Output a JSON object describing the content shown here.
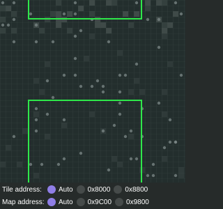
{
  "tile_address": {
    "label": "Tile address:",
    "options": [
      {
        "label": "Auto",
        "selected": true
      },
      {
        "label": "0x8000",
        "selected": false
      },
      {
        "label": "0x8800",
        "selected": false
      }
    ]
  },
  "map_address": {
    "label": "Map address:",
    "options": [
      {
        "label": "Auto",
        "selected": true
      },
      {
        "label": "0x9C00",
        "selected": false
      },
      {
        "label": "0x9800",
        "selected": false
      }
    ]
  },
  "colors": {
    "accent": "#8f7ee6",
    "viewport_outline": "#2ee84a",
    "background": "#232e2d"
  }
}
